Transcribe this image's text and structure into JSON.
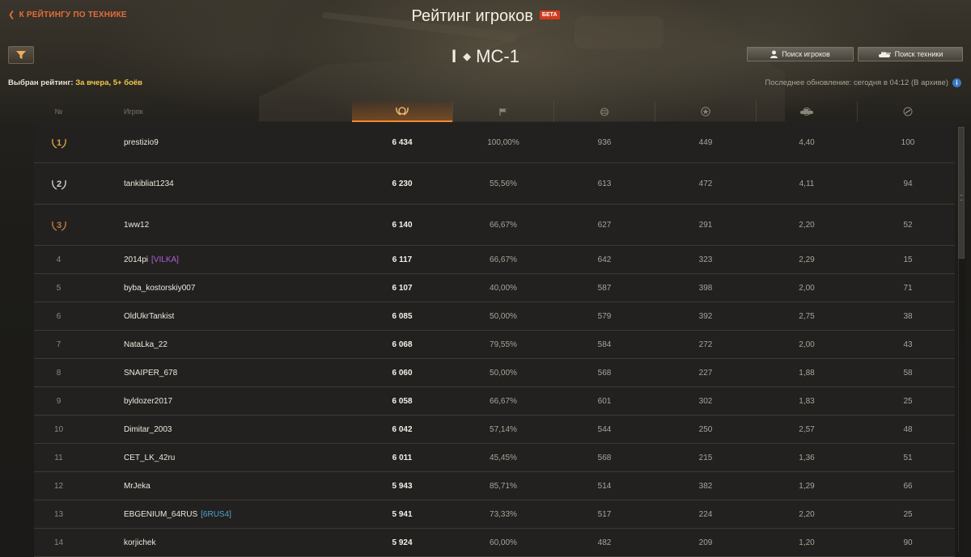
{
  "header": {
    "back_label": "К РЕЙТИНГУ ПО ТЕХНИКЕ",
    "title": "Рейтинг игроков",
    "beta_badge": "БЕТА",
    "vehicle_tier": "I",
    "vehicle_name": "МС-1",
    "selected_rating_label": "Выбран рейтинг:",
    "selected_rating_value": "За вчера, 5+ боёв",
    "search_players_label": "Поиск игроков",
    "search_vehicles_label": "Поиск техники",
    "last_update": "Последнее обновление: сегодня в 04:12 (В архиве)"
  },
  "table": {
    "columns": {
      "num": "№",
      "player": "Игрок"
    },
    "column_icons": [
      "rating-laurel-icon",
      "flag-icon",
      "damage-arrows-icon",
      "star-icon",
      "tank-kills-icon",
      "spotting-icon"
    ],
    "rows": [
      {
        "rank": "1",
        "name": "prestizio9",
        "clan": "",
        "rating": "6 434",
        "winrate": "100,00%",
        "damage": "936",
        "experience": "449",
        "frags": "4,40",
        "spotted": "100"
      },
      {
        "rank": "2",
        "name": "tankibliat1234",
        "clan": "",
        "rating": "6 230",
        "winrate": "55,56%",
        "damage": "613",
        "experience": "472",
        "frags": "4,11",
        "spotted": "94"
      },
      {
        "rank": "3",
        "name": "1ww12",
        "clan": "",
        "rating": "6 140",
        "winrate": "66,67%",
        "damage": "627",
        "experience": "291",
        "frags": "2,20",
        "spotted": "52"
      },
      {
        "rank": "4",
        "name": "2014pi",
        "clan": "[VILKA]",
        "clan_color": "#b05fd3",
        "rating": "6 117",
        "winrate": "66,67%",
        "damage": "642",
        "experience": "323",
        "frags": "2,29",
        "spotted": "15"
      },
      {
        "rank": "5",
        "name": "byba_kostorskiy007",
        "clan": "",
        "rating": "6 107",
        "winrate": "40,00%",
        "damage": "587",
        "experience": "398",
        "frags": "2,00",
        "spotted": "71"
      },
      {
        "rank": "6",
        "name": "OldUkrTankist",
        "clan": "",
        "rating": "6 085",
        "winrate": "50,00%",
        "damage": "579",
        "experience": "392",
        "frags": "2,75",
        "spotted": "38"
      },
      {
        "rank": "7",
        "name": "NataLka_22",
        "clan": "",
        "rating": "6 068",
        "winrate": "79,55%",
        "damage": "584",
        "experience": "272",
        "frags": "2,00",
        "spotted": "43"
      },
      {
        "rank": "8",
        "name": "SNAIPER_678",
        "clan": "",
        "rating": "6 060",
        "winrate": "50,00%",
        "damage": "568",
        "experience": "227",
        "frags": "1,88",
        "spotted": "58"
      },
      {
        "rank": "9",
        "name": "byldozer2017",
        "clan": "",
        "rating": "6 058",
        "winrate": "66,67%",
        "damage": "601",
        "experience": "302",
        "frags": "1,83",
        "spotted": "25"
      },
      {
        "rank": "10",
        "name": "Dimitar_2003",
        "clan": "",
        "rating": "6 042",
        "winrate": "57,14%",
        "damage": "544",
        "experience": "250",
        "frags": "2,57",
        "spotted": "48"
      },
      {
        "rank": "11",
        "name": "CET_LK_42ru",
        "clan": "",
        "rating": "6 011",
        "winrate": "45,45%",
        "damage": "568",
        "experience": "215",
        "frags": "1,36",
        "spotted": "51"
      },
      {
        "rank": "12",
        "name": "MrJeka",
        "clan": "",
        "rating": "5 943",
        "winrate": "85,71%",
        "damage": "514",
        "experience": "382",
        "frags": "1,29",
        "spotted": "66"
      },
      {
        "rank": "13",
        "name": "EBGENIUM_64RUS",
        "clan": "[6RUS4]",
        "clan_color": "#4fa3c9",
        "rating": "5 941",
        "winrate": "73,33%",
        "damage": "517",
        "experience": "224",
        "frags": "2,20",
        "spotted": "25"
      },
      {
        "rank": "14",
        "name": "korjichek",
        "clan": "",
        "rating": "5 924",
        "winrate": "60,00%",
        "damage": "482",
        "experience": "209",
        "frags": "1,20",
        "spotted": "90"
      }
    ]
  },
  "colors": {
    "accent_orange": "#e36e3b",
    "selected_value_yellow": "#f2c94c",
    "beta_red": "#d33a1d",
    "gold": "#d8a24a",
    "silver": "#cfcfcf",
    "bronze": "#c07a3c"
  }
}
